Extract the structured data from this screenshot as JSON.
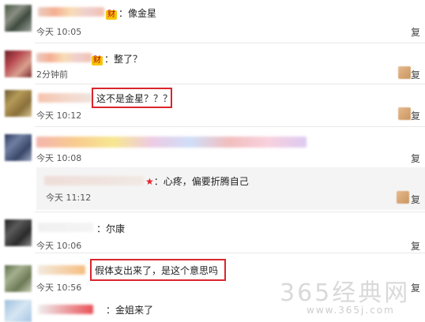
{
  "comments": [
    {
      "badge": "财",
      "text": "：像金星",
      "time": "今天 10:05",
      "reply": "复"
    },
    {
      "badge": "财",
      "text": "：整了？",
      "time": "2分钟前",
      "reply": "复"
    },
    {
      "text": "这不是金星？？？",
      "time": "今天 10:12",
      "reply": "复"
    },
    {
      "time": "今天 10:08",
      "reply": "复"
    },
    {
      "text": "：心疼，偏要折腾自己",
      "time": "今天 11:12",
      "reply": "复"
    },
    {
      "text": "：尔康",
      "time": "今天 10:06",
      "reply": "复"
    },
    {
      "text": "假体支出来了，是这个意思吗",
      "time": "今天 10:56",
      "reply": "复"
    },
    {
      "text": "：金姐来了"
    }
  ],
  "watermark": {
    "main": "365经典网",
    "url": "www.365j.com"
  }
}
